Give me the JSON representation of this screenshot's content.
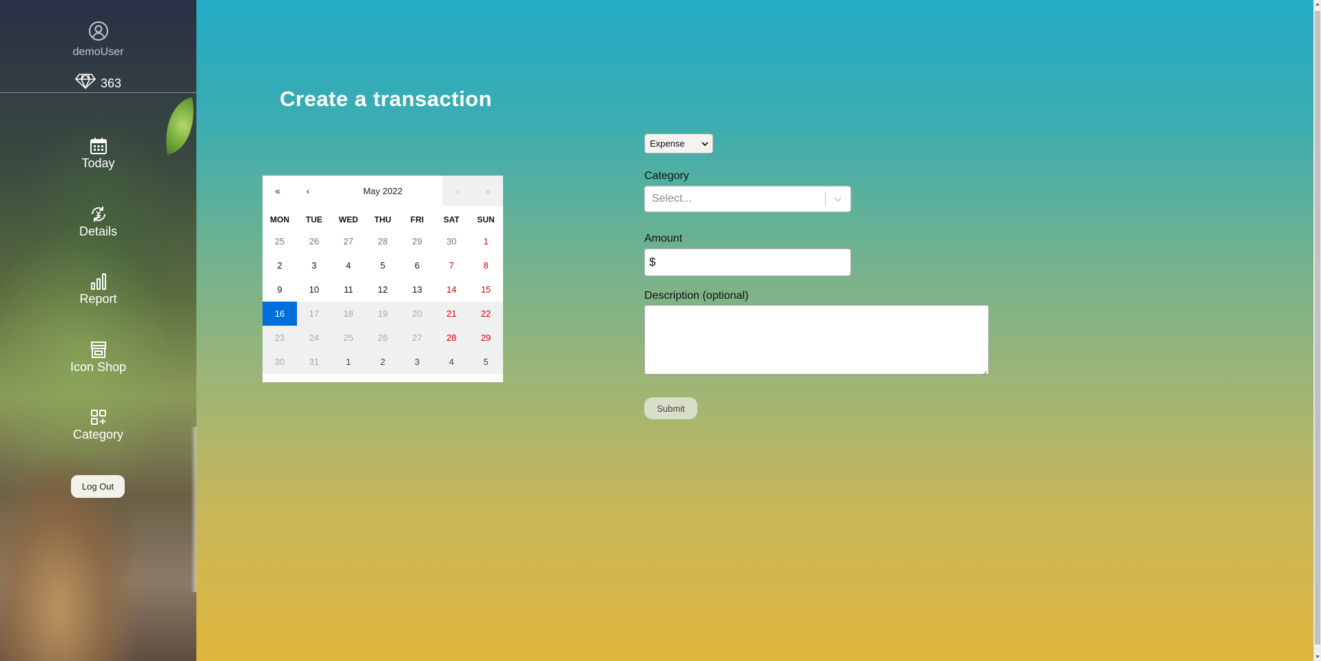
{
  "user": {
    "username": "demoUser",
    "gems": "363"
  },
  "nav": {
    "today": "Today",
    "details": "Details",
    "report": "Report",
    "icon_shop": "Icon Shop",
    "category": "Category",
    "logout": "Log Out"
  },
  "page": {
    "title": "Create a transaction"
  },
  "calendar": {
    "nav_prev2": "«",
    "nav_prev": "‹",
    "label": "May 2022",
    "nav_next": "›",
    "nav_next2": "»",
    "weekdays": [
      "MON",
      "TUE",
      "WED",
      "THU",
      "FRI",
      "SAT",
      "SUN"
    ],
    "weeks": [
      [
        "25",
        "26",
        "27",
        "28",
        "29",
        "30",
        "1"
      ],
      [
        "2",
        "3",
        "4",
        "5",
        "6",
        "7",
        "8"
      ],
      [
        "9",
        "10",
        "11",
        "12",
        "13",
        "14",
        "15"
      ],
      [
        "16",
        "17",
        "18",
        "19",
        "20",
        "21",
        "22"
      ],
      [
        "23",
        "24",
        "25",
        "26",
        "27",
        "28",
        "29"
      ],
      [
        "30",
        "31",
        "1",
        "2",
        "3",
        "4",
        "5"
      ]
    ],
    "selected": "16"
  },
  "form": {
    "type_value": "Expense",
    "category_label": "Category",
    "category_placeholder": "Select...",
    "amount_label": "Amount",
    "amount_prefix": "$",
    "description_label": "Description (optional)",
    "submit": "Submit"
  },
  "colors": {
    "selected_day": "#006edc",
    "weekend": "#d10000",
    "gradient_top": "#24abc6",
    "gradient_bottom": "#e0b63c"
  }
}
